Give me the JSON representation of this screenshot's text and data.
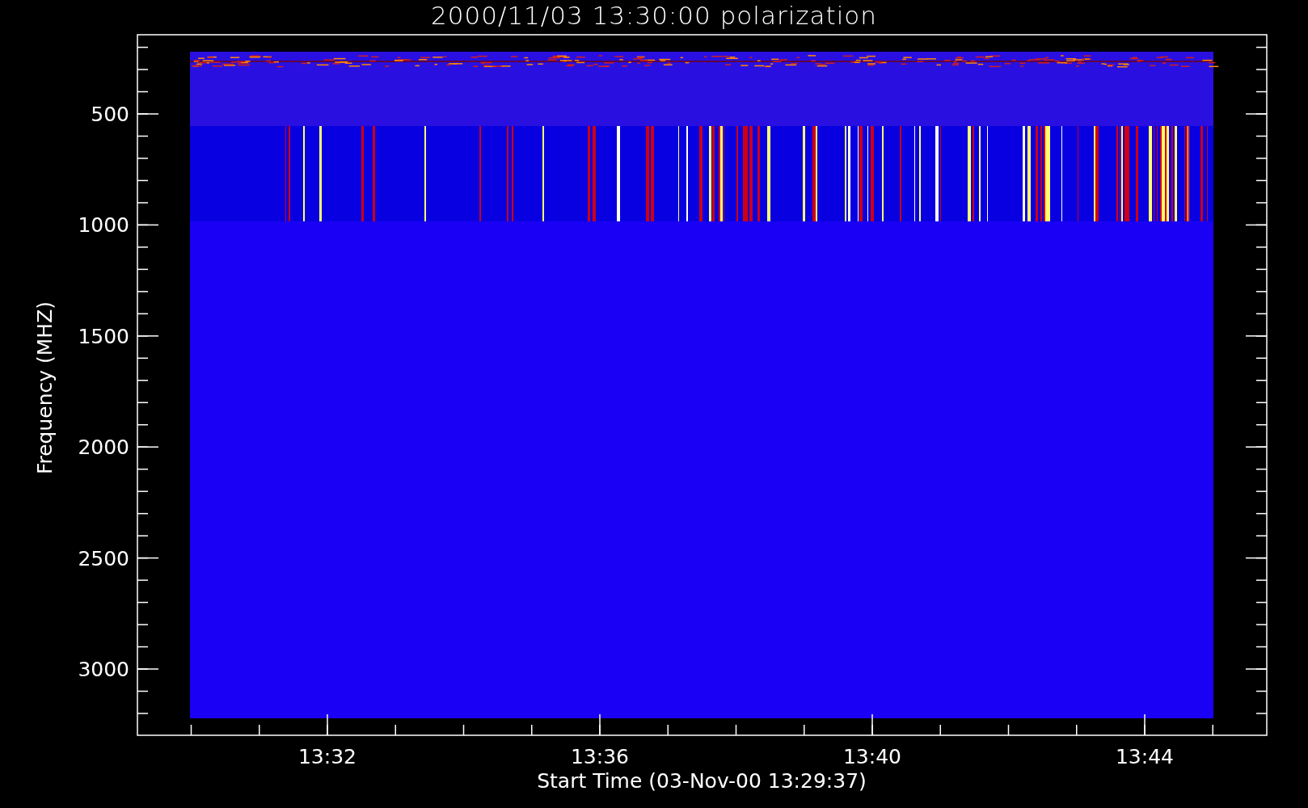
{
  "title": "2000/11/03 13:30:00 polarization",
  "y_axis": {
    "label": "Frequency (MHZ)",
    "ticks": [
      "500",
      "1000",
      "1500",
      "2000",
      "2500",
      "3000"
    ]
  },
  "x_axis": {
    "label": "Start Time (03-Nov-00 13:29:37)",
    "ticks": [
      "13:32",
      "13:36",
      "13:40",
      "13:44"
    ]
  }
}
